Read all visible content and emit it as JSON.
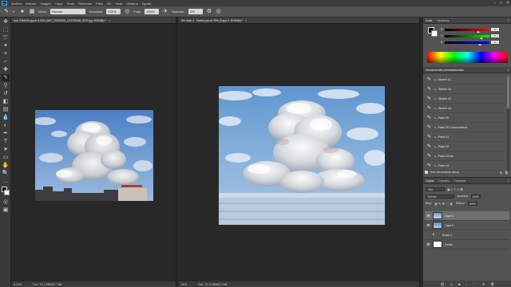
{
  "menubar": {
    "logo": "Ps",
    "items": [
      "Archivo",
      "Edición",
      "Imagen",
      "Capa",
      "Texto",
      "Selección",
      "Filtro",
      "3D",
      "Vista",
      "Ventana",
      "Ayuda"
    ],
    "window_controls": [
      "–",
      "□",
      "✕"
    ]
  },
  "options": {
    "mode_label": "Modo:",
    "mode_value": "Normal",
    "opacity_label": "Opacidad:",
    "opacity_value": "100%",
    "flow_label": "Flujo:",
    "flow_value": "100%",
    "smoothing_label": "Suavizar:",
    "smoothing_value": "0%"
  },
  "documents": [
    {
      "tab_title": "bob-7084630.jpg al 8,33% (IMG_20180408_103729448_HDR.jpg, RGB/8#) *",
      "close": "×",
      "zoom": "8,33%",
      "doc_size": "Doc: 34,3 MB/68,7 MB"
    },
    {
      "tab_title": "Sin título-4 - Nubes.psd al 25% (Capa 4, RGB/8#) *",
      "close": "×",
      "zoom": "25%",
      "doc_size": "Doc: 34,3 MB/68,7 MB"
    }
  ],
  "color_panel": {
    "tabs": [
      "Color",
      "Muestras"
    ],
    "sliders": [
      {
        "letter": "R",
        "value": "0",
        "fraction": 0.72
      },
      {
        "letter": "G",
        "value": "0",
        "fraction": 0.78
      },
      {
        "letter": "B",
        "value": "0",
        "fraction": 0.75
      }
    ]
  },
  "presets_panel": {
    "title": "Herramientas preestablecidas",
    "items": [
      "c - Sketch 01",
      "c - Sketch 02",
      "c - Sketch 03",
      "c - Sketch 04",
      "c - Paint 00",
      "c - Paint 00 Colors texture",
      "c - Paint 01",
      "c - Paint 02",
      "c - Paint 03 bis",
      "c - Paint 04"
    ],
    "footer_label": "Solo herramienta actual"
  },
  "layers_panel": {
    "tabs": [
      "Capas",
      "Canales",
      "Trazados"
    ],
    "kind_label": "Tipo",
    "blend_mode": "Normal",
    "opacity_label": "Opacidad:",
    "opacity_value": "100%",
    "lock_label": "Bloq.:",
    "fill_label": "Relleno:",
    "fill_value": "100%",
    "layers": [
      {
        "name": "Capa 4",
        "selected": true
      },
      {
        "name": "Capa 2",
        "selected": false
      },
      {
        "name": "Grupo 1",
        "selected": false
      },
      {
        "name": "Fondo",
        "selected": false
      }
    ]
  },
  "colors": {
    "foreground": "#000000",
    "background": "#ffffff",
    "app_bg": "#282828",
    "panel_bg": "#535353"
  }
}
